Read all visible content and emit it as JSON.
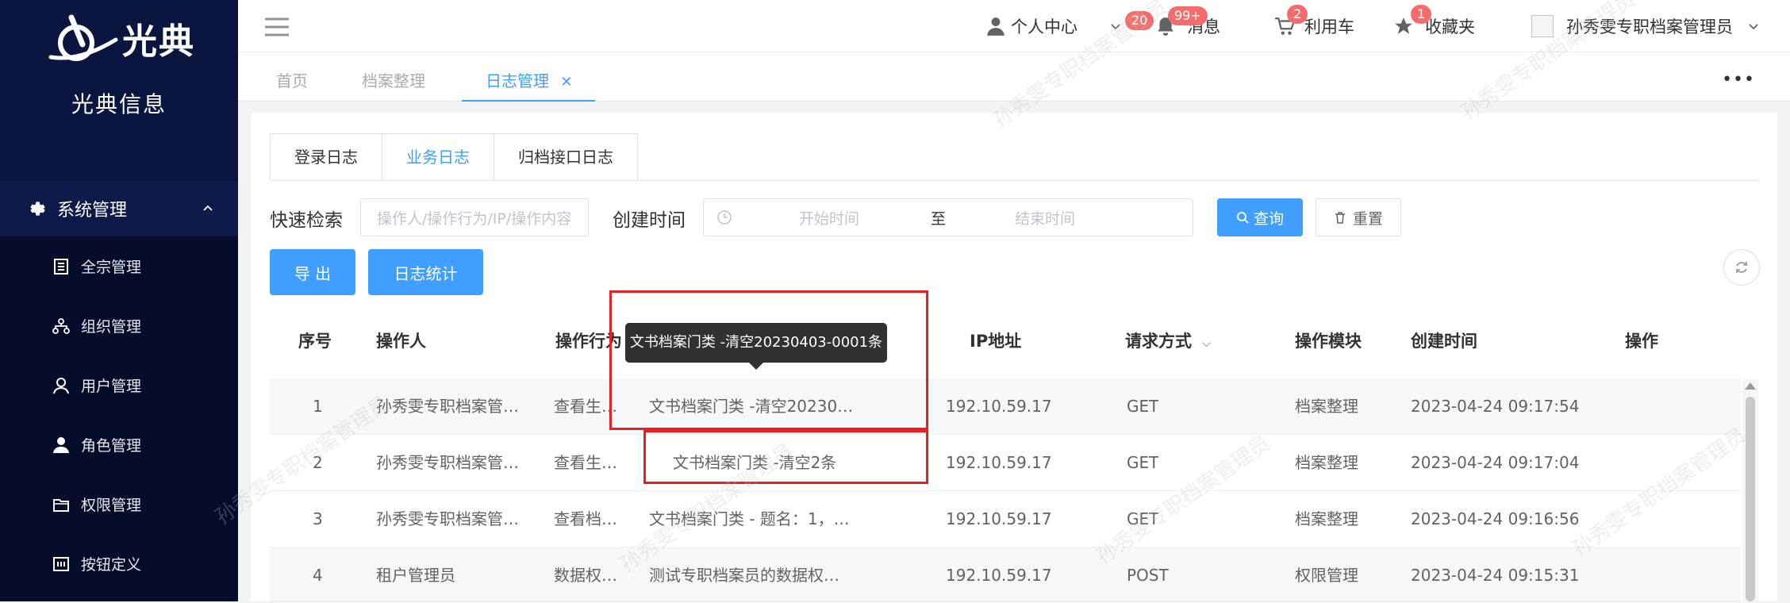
{
  "sidebar": {
    "logo_text": "光典",
    "brand": "光典信息",
    "group": "系统管理",
    "items": [
      {
        "label": "全宗管理",
        "icon": "document-icon"
      },
      {
        "label": "组织管理",
        "icon": "org-tree-icon"
      },
      {
        "label": "用户管理",
        "icon": "user-icon"
      },
      {
        "label": "角色管理",
        "icon": "role-icon"
      },
      {
        "label": "权限管理",
        "icon": "folder-icon"
      },
      {
        "label": "按钮定义",
        "icon": "button-icon"
      }
    ]
  },
  "header": {
    "personal_center": "个人中心",
    "personal_badge": "20",
    "messages": "消息",
    "messages_badge": "99+",
    "cart": "利用车",
    "cart_badge": "2",
    "favorites": "收藏夹",
    "favorites_badge": "1",
    "username": "孙秀雯专职档案管理员"
  },
  "tabs": [
    {
      "label": "首页"
    },
    {
      "label": "档案整理"
    },
    {
      "label": "日志管理"
    }
  ],
  "log_tabs": [
    "登录日志",
    "业务日志",
    "归档接口日志"
  ],
  "filters": {
    "quick_search_label": "快速检索",
    "quick_search_placeholder": "操作人/操作行为/IP/操作内容",
    "created_label": "创建时间",
    "start_placeholder": "开始时间",
    "range_separator": "至",
    "end_placeholder": "结束时间",
    "query_button": "查询",
    "reset_button": "重置"
  },
  "actions": {
    "export_button": "导 出",
    "stats_button": "日志统计"
  },
  "table": {
    "columns": [
      "序号",
      "操作人",
      "操作行为",
      "IP地址",
      "请求方式",
      "操作模块",
      "创建时间",
      "操作"
    ],
    "rows": [
      {
        "no": "1",
        "operator": "孙秀雯专职档案管…",
        "action": "查看生…",
        "content": "文书档案门类 -清空20230…",
        "ip": "192.10.59.17",
        "method": "GET",
        "module": "档案整理",
        "time": "2023-04-24 09:17:54"
      },
      {
        "no": "2",
        "operator": "孙秀雯专职档案管…",
        "action": "查看生…",
        "content": "文书档案门类 -清空2条",
        "ip": "192.10.59.17",
        "method": "GET",
        "module": "档案整理",
        "time": "2023-04-24 09:17:04"
      },
      {
        "no": "3",
        "operator": "孙秀雯专职档案管…",
        "action": "查看档…",
        "content": "文书档案门类 - 题名：1，…",
        "ip": "192.10.59.17",
        "method": "GET",
        "module": "档案整理",
        "time": "2023-04-24 09:16:56"
      },
      {
        "no": "4",
        "operator": "租户管理员",
        "action": "数据权…",
        "content": "测试专职档案员的数据权…",
        "ip": "192.10.59.17",
        "method": "POST",
        "module": "权限管理",
        "time": "2023-04-24 09:15:31"
      }
    ]
  },
  "tooltip": "文书档案门类 -清空20230403-0001条",
  "watermark": "孙秀雯专职档案管理员",
  "colors": {
    "primary": "#409eff",
    "sidebar": "#0b1640",
    "badge": "#f56c6c",
    "highlight": "#ee1d23"
  }
}
